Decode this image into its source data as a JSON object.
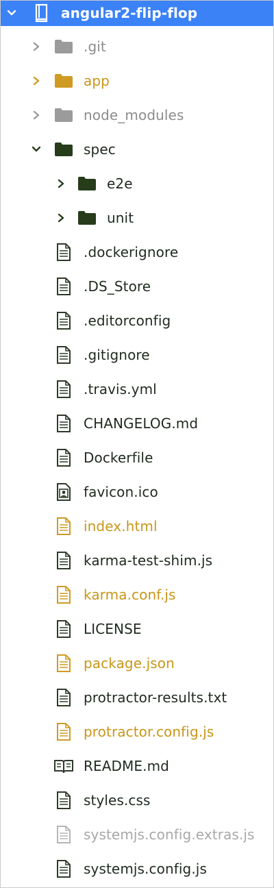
{
  "colors": {
    "selection": "#3b82f7",
    "default_text": "#1f2a1f",
    "ignored_text": "#8c8c8c",
    "modified_text": "#c89619",
    "faint_text": "#a8a8a8",
    "folder_dark": "#263c1b",
    "folder_grey": "#9b9b9b",
    "folder_modified": "#cf9b22"
  },
  "tree": {
    "root": {
      "label": "angular2-flip-flop",
      "icon": "repo-book-icon",
      "expanded": true
    },
    "items": [
      {
        "label": ".git",
        "type": "folder",
        "status": "ignored",
        "expanded": false,
        "icon": "folder-icon"
      },
      {
        "label": "app",
        "type": "folder",
        "status": "modified",
        "expanded": false,
        "icon": "folder-icon"
      },
      {
        "label": "node_modules",
        "type": "folder",
        "status": "ignored",
        "expanded": false,
        "icon": "folder-icon"
      },
      {
        "label": "spec",
        "type": "folder",
        "status": "default",
        "expanded": true,
        "icon": "folder-icon"
      },
      {
        "label": "e2e",
        "type": "folder",
        "status": "default",
        "expanded": false,
        "icon": "folder-icon"
      },
      {
        "label": "unit",
        "type": "folder",
        "status": "default",
        "expanded": false,
        "icon": "folder-icon"
      },
      {
        "label": ".dockerignore",
        "type": "file",
        "status": "default",
        "icon": "file-text-icon"
      },
      {
        "label": ".DS_Store",
        "type": "file",
        "status": "default",
        "icon": "file-text-icon"
      },
      {
        "label": ".editorconfig",
        "type": "file",
        "status": "default",
        "icon": "file-text-icon"
      },
      {
        "label": ".gitignore",
        "type": "file",
        "status": "default",
        "icon": "file-text-icon"
      },
      {
        "label": ".travis.yml",
        "type": "file",
        "status": "default",
        "icon": "file-text-icon"
      },
      {
        "label": "CHANGELOG.md",
        "type": "file",
        "status": "default",
        "icon": "file-text-icon"
      },
      {
        "label": "Dockerfile",
        "type": "file",
        "status": "default",
        "icon": "file-text-icon"
      },
      {
        "label": "favicon.ico",
        "type": "file",
        "status": "default",
        "icon": "file-media-icon"
      },
      {
        "label": "index.html",
        "type": "file",
        "status": "modified",
        "icon": "file-text-icon"
      },
      {
        "label": "karma-test-shim.js",
        "type": "file",
        "status": "default",
        "icon": "file-text-icon"
      },
      {
        "label": "karma.conf.js",
        "type": "file",
        "status": "modified",
        "icon": "file-text-icon"
      },
      {
        "label": "LICENSE",
        "type": "file",
        "status": "default",
        "icon": "file-text-icon"
      },
      {
        "label": "package.json",
        "type": "file",
        "status": "modified",
        "icon": "file-text-icon"
      },
      {
        "label": "protractor-results.txt",
        "type": "file",
        "status": "default",
        "icon": "file-text-icon"
      },
      {
        "label": "protractor.config.js",
        "type": "file",
        "status": "modified",
        "icon": "file-text-icon"
      },
      {
        "label": "README.md",
        "type": "file",
        "status": "default",
        "icon": "book-icon"
      },
      {
        "label": "styles.css",
        "type": "file",
        "status": "default",
        "icon": "file-text-icon"
      },
      {
        "label": "systemjs.config.extras.js",
        "type": "file",
        "status": "faint",
        "icon": "file-text-icon"
      },
      {
        "label": "systemjs.config.js",
        "type": "file",
        "status": "default",
        "icon": "file-text-icon"
      }
    ]
  }
}
